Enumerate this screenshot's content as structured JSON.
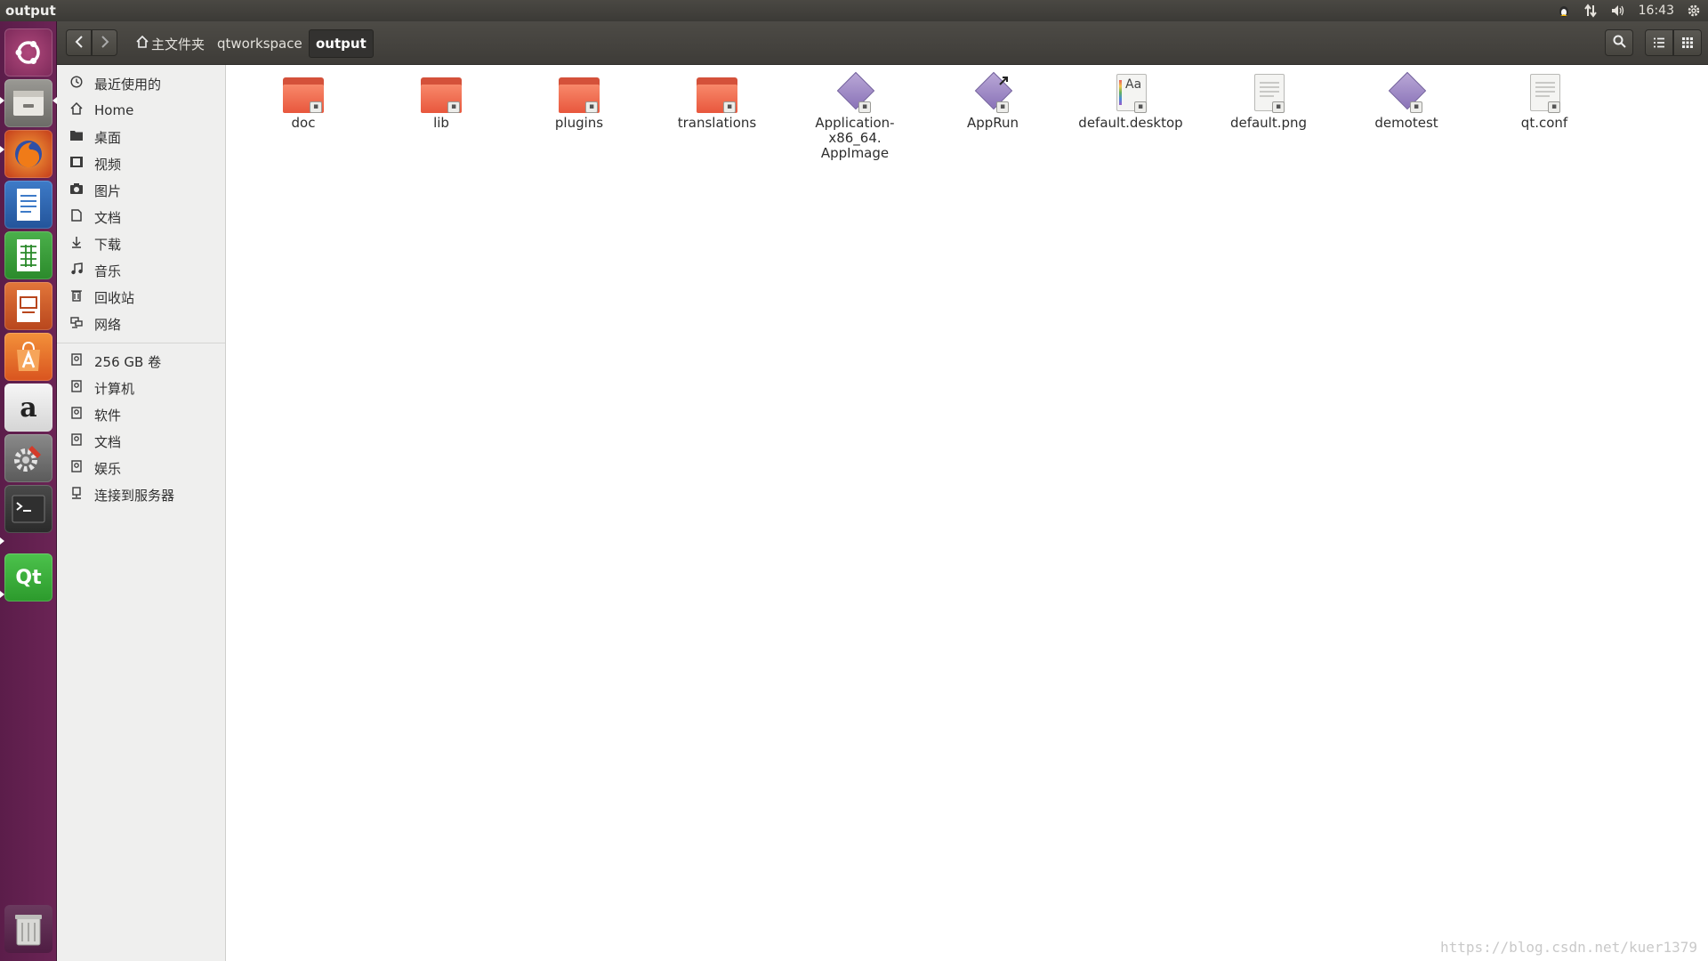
{
  "window": {
    "title": "output"
  },
  "tray": {
    "clock": "16:43"
  },
  "breadcrumbs": [
    {
      "label": "主文件夹"
    },
    {
      "label": "qtworkspace"
    },
    {
      "label": "output"
    }
  ],
  "launcher": {
    "apps": [
      {
        "name": "ubuntu-dash-icon"
      },
      {
        "name": "files-icon"
      },
      {
        "name": "firefox-icon"
      },
      {
        "name": "libreoffice-writer-icon"
      },
      {
        "name": "libreoffice-calc-icon"
      },
      {
        "name": "libreoffice-impress-icon"
      },
      {
        "name": "software-center-icon"
      },
      {
        "name": "amazon-icon"
      },
      {
        "name": "system-settings-icon"
      },
      {
        "name": "terminal-icon"
      },
      {
        "name": "qt-creator-icon",
        "label": "Qt"
      },
      {
        "name": "trash-icon"
      }
    ],
    "amazon_glyph": "a"
  },
  "sidebar": {
    "places": [
      {
        "label": "最近使用的",
        "icon": "clock-icon"
      },
      {
        "label": "Home",
        "icon": "home-icon"
      },
      {
        "label": "桌面",
        "icon": "folder-icon"
      },
      {
        "label": "视频",
        "icon": "video-icon"
      },
      {
        "label": "图片",
        "icon": "camera-icon"
      },
      {
        "label": "文档",
        "icon": "document-icon"
      },
      {
        "label": "下载",
        "icon": "download-icon"
      },
      {
        "label": "音乐",
        "icon": "music-icon"
      },
      {
        "label": "回收站",
        "icon": "trash-icon"
      },
      {
        "label": "网络",
        "icon": "network-icon"
      }
    ],
    "devices": [
      {
        "label": "256 GB 卷",
        "icon": "drive-icon"
      },
      {
        "label": "计算机",
        "icon": "drive-icon"
      },
      {
        "label": "软件",
        "icon": "drive-icon"
      },
      {
        "label": "文档",
        "icon": "drive-icon"
      },
      {
        "label": "娱乐",
        "icon": "drive-icon"
      },
      {
        "label": "连接到服务器",
        "icon": "server-icon"
      }
    ]
  },
  "files": [
    {
      "name": "doc",
      "kind": "folder"
    },
    {
      "name": "lib",
      "kind": "folder"
    },
    {
      "name": "plugins",
      "kind": "folder"
    },
    {
      "name": "translations",
      "kind": "folder"
    },
    {
      "name": "Application-x86_64.\nAppImage",
      "kind": "executable"
    },
    {
      "name": "AppRun",
      "kind": "link"
    },
    {
      "name": "default.desktop",
      "kind": "font"
    },
    {
      "name": "default.png",
      "kind": "text"
    },
    {
      "name": "demotest",
      "kind": "executable"
    },
    {
      "name": "qt.conf",
      "kind": "text"
    }
  ],
  "font_preview_glyph": "Aa",
  "watermark": "https://blog.csdn.net/kuer1379",
  "colors": {
    "launcher": "#5b1d4a",
    "folder": "#e8573d",
    "panel": "#3b3a36"
  }
}
